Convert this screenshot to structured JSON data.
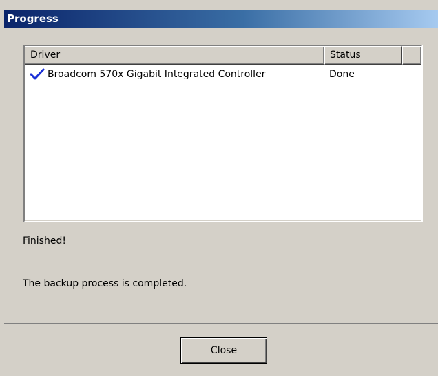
{
  "window": {
    "title": "Progress"
  },
  "driver_list": {
    "columns": {
      "driver": "Driver",
      "status": "Status"
    },
    "rows": [
      {
        "icon": "check-icon",
        "driver": "Broadcom 570x Gigabit Integrated Controller",
        "status": "Done"
      }
    ]
  },
  "progress": {
    "status_text": "Finished!",
    "percent": 0,
    "message": "The backup process is completed."
  },
  "buttons": {
    "close_label": "Close"
  },
  "colors": {
    "titlebar_start": "#0a246a",
    "titlebar_end": "#a6caf0",
    "dialog_bg": "#d4d0c8",
    "check": "#1a2fd6"
  }
}
